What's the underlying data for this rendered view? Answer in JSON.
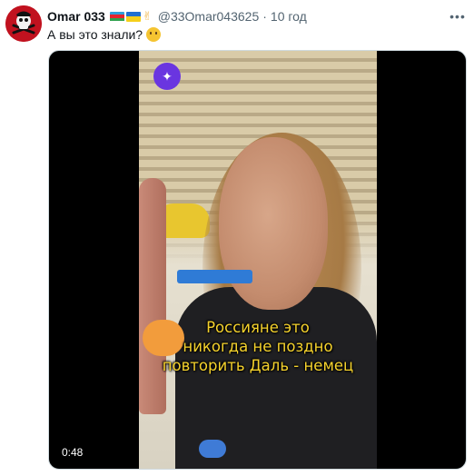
{
  "tweet": {
    "author_name": "Omar 033",
    "handle": "@33Omar043625",
    "separator": "·",
    "time_ago": "10 год",
    "text": "А вы это знали?",
    "more_label": "•••",
    "flags": [
      "azerbaijan-flag",
      "ukraine-flag"
    ],
    "hand_icon": "victory-hand-icon",
    "emoji": "thinking-face-icon"
  },
  "video": {
    "badge_icon": "sparkles-icon",
    "badge_symbol": "✦",
    "caption_lines": [
      "Россияне это",
      "никогда не поздно",
      "повторить Даль - немец"
    ],
    "duration": "0:48"
  },
  "colors": {
    "avatar_bg": "#c1121f",
    "caption": "#f6d32d",
    "badge": "#6a35e0",
    "secondary_text": "#536471"
  }
}
